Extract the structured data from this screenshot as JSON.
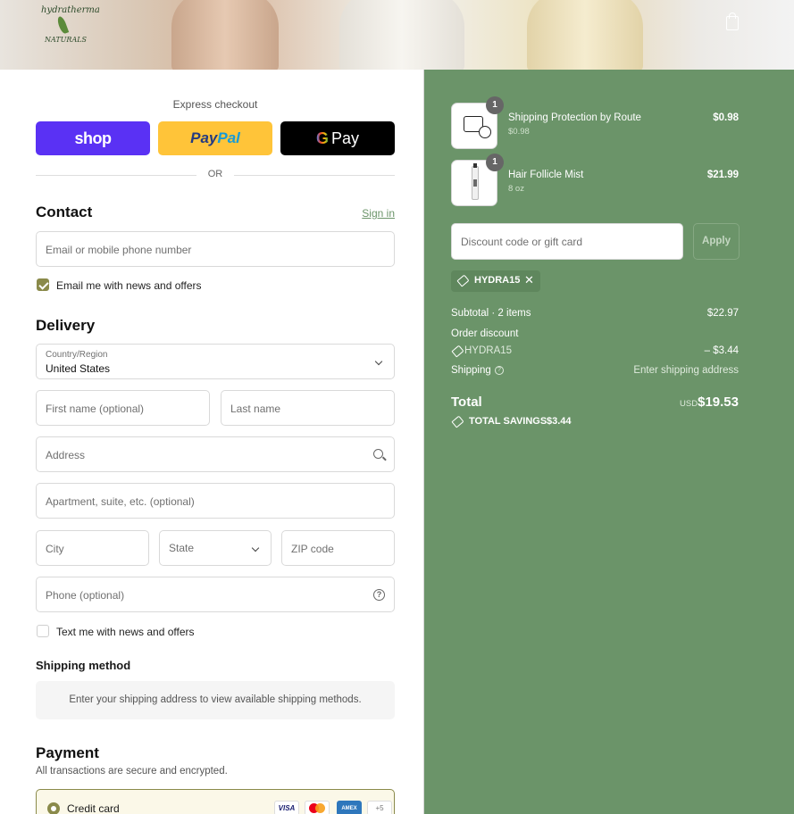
{
  "brand": {
    "logo_line1": "hydratherma",
    "logo_line2": "NATURALS"
  },
  "express": {
    "label": "Express checkout",
    "shop_label": "shop",
    "paypal_pay": "Pay",
    "paypal_pal": "Pal",
    "gpay_g": "G",
    "gpay_label": "Pay",
    "or": "OR"
  },
  "contact": {
    "title": "Contact",
    "signin": "Sign in",
    "email_placeholder": "Email or mobile phone number",
    "newsletter_label": "Email me with news and offers",
    "newsletter_checked": true
  },
  "delivery": {
    "title": "Delivery",
    "country_label": "Country/Region",
    "country_value": "United States",
    "first_name_placeholder": "First name (optional)",
    "last_name_placeholder": "Last name",
    "address_placeholder": "Address",
    "apartment_placeholder": "Apartment, suite, etc. (optional)",
    "city_placeholder": "City",
    "state_placeholder": "State",
    "zip_placeholder": "ZIP code",
    "phone_placeholder": "Phone (optional)",
    "sms_label": "Text me with news and offers",
    "sms_checked": false
  },
  "shipping_method": {
    "title": "Shipping method",
    "message": "Enter your shipping address to view available shipping methods."
  },
  "payment": {
    "title": "Payment",
    "subtitle": "All transactions are secure and encrypted.",
    "credit_card_label": "Credit card",
    "cards": [
      "VISA",
      "AMEX",
      "+5"
    ]
  },
  "cart": {
    "items": [
      {
        "name": "Shipping Protection by Route",
        "sub": "$0.98",
        "price": "$0.98",
        "qty": "1",
        "icon": "route-protection-icon"
      },
      {
        "name": "Hair Follicle Mist",
        "sub": "8 oz",
        "price": "$21.99",
        "qty": "1",
        "icon": "spray-bottle"
      }
    ],
    "discount_placeholder": "Discount code or gift card",
    "apply_label": "Apply",
    "applied_code": "HYDRA15",
    "subtotal_label": "Subtotal · 2 items",
    "subtotal_value": "$22.97",
    "order_discount_label": "Order discount",
    "discount_code": "HYDRA15",
    "discount_value": "– $3.44",
    "shipping_label": "Shipping",
    "shipping_value": "Enter shipping address",
    "total_label": "Total",
    "currency": "USD",
    "total_value": "$19.53",
    "savings_label": "TOTAL SAVINGS",
    "savings_value": "$3.44"
  },
  "colors": {
    "accent": "#8a8a4a",
    "summary_bg": "#6b9469",
    "shop_pay": "#5a31f4",
    "paypal": "#ffc439"
  }
}
